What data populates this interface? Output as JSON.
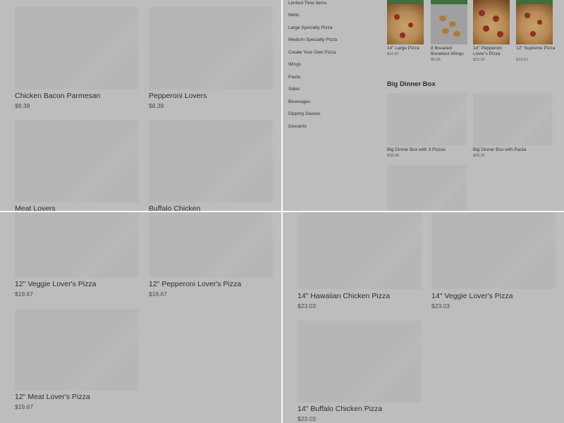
{
  "q1": {
    "items": [
      {
        "name": "Chicken Bacon Parmesan",
        "price": "$8.39"
      },
      {
        "name": "Pepperoni Lovers",
        "price": "$8.39"
      },
      {
        "name": "Meat Lovers",
        "price": ""
      },
      {
        "name": "Buffalo Chicken",
        "price": ""
      }
    ]
  },
  "q2": {
    "categories": [
      "Limited Time Items",
      "Melts",
      "Large Specialty Pizza",
      "Medium Specialty Pizza",
      "Create Your Own Pizza",
      "Wings",
      "Pasta",
      "Sides",
      "Beverages",
      "Dipping Sauces",
      "Desserts"
    ],
    "featured": [
      {
        "name": "14\" Large Pizza",
        "price": "$16.67"
      },
      {
        "name": "8 Breaded Boneless Wings",
        "price": "$9.95"
      },
      {
        "name": "14\" Pepperoni Lover's Pizza",
        "price": "$23.03"
      },
      {
        "name": "12\" Supreme Pizza",
        "price": "$19.67"
      }
    ],
    "section_title": "Big Dinner Box",
    "boxes": [
      {
        "name": "Big Dinner Box with 3 Pizzas",
        "price": "$28.08"
      },
      {
        "name": "Big Dinner Box with Pasta",
        "price": "$28.31"
      }
    ]
  },
  "q3": {
    "items": [
      {
        "name": "12\" Veggie Lover's Pizza",
        "price": "$19.67"
      },
      {
        "name": "12\" Pepperoni Lover's Pizza",
        "price": "$19.67"
      },
      {
        "name": "12\" Meat Lover's Pizza",
        "price": "$19.67"
      }
    ]
  },
  "q4": {
    "items": [
      {
        "name": "14\" Hawaiian Chicken Pizza",
        "price": "$23.03"
      },
      {
        "name": "14\" Veggie Lover's Pizza",
        "price": "$23.03"
      },
      {
        "name": "14\" Buffalo Chicken Pizza",
        "price": "$23.03"
      }
    ]
  }
}
